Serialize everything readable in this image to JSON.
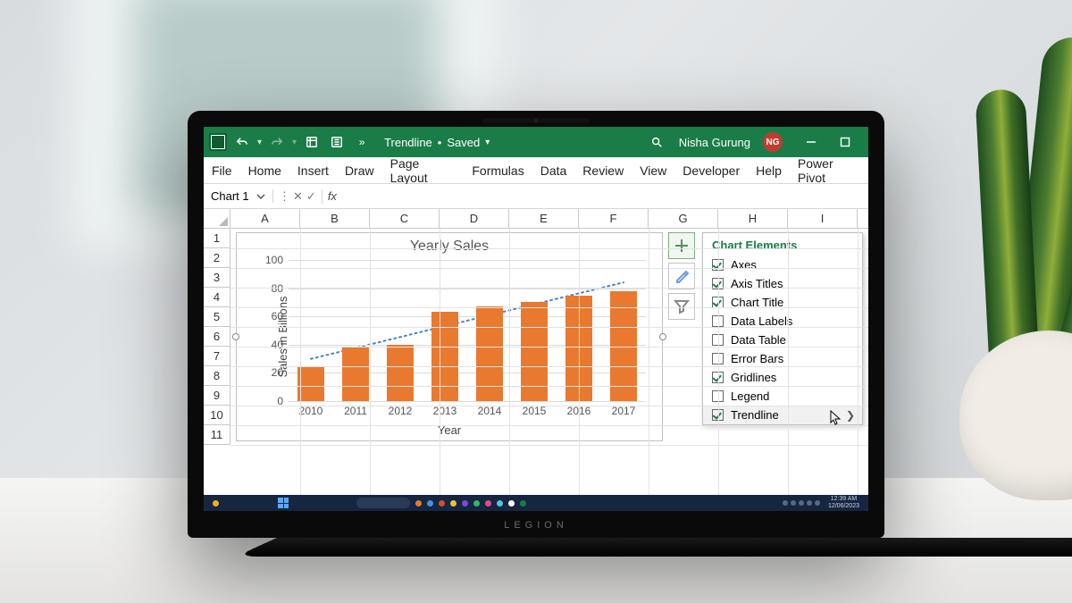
{
  "titlebar": {
    "doc_name": "Trendline",
    "save_state": "Saved",
    "user_name": "Nisha Gurung",
    "user_initials": "NG"
  },
  "ribbon_tabs": [
    "File",
    "Home",
    "Insert",
    "Draw",
    "Page Layout",
    "Formulas",
    "Data",
    "Review",
    "View",
    "Developer",
    "Help",
    "Power Pivot"
  ],
  "namebox": {
    "value": "Chart 1"
  },
  "fx": {
    "label": "fx",
    "value": ""
  },
  "columns": [
    "A",
    "B",
    "C",
    "D",
    "E",
    "F",
    "G",
    "H",
    "I"
  ],
  "rows": [
    "1",
    "2",
    "3",
    "4",
    "5",
    "6",
    "7",
    "8",
    "9",
    "10",
    "11"
  ],
  "chart_elements": {
    "title": "Chart Elements",
    "items": [
      {
        "label": "Axes",
        "checked": true
      },
      {
        "label": "Axis Titles",
        "checked": true
      },
      {
        "label": "Chart Title",
        "checked": true
      },
      {
        "label": "Data Labels",
        "checked": false
      },
      {
        "label": "Data Table",
        "checked": false
      },
      {
        "label": "Error Bars",
        "checked": false
      },
      {
        "label": "Gridlines",
        "checked": true
      },
      {
        "label": "Legend",
        "checked": false
      },
      {
        "label": "Trendline",
        "checked": true,
        "hover": true,
        "expand": true
      }
    ]
  },
  "chart_data": {
    "type": "bar",
    "title": "Yearly Sales",
    "xlabel": "Year",
    "ylabel": "Sales in Billions",
    "categories": [
      "2010",
      "2011",
      "2012",
      "2013",
      "2014",
      "2015",
      "2016",
      "2017"
    ],
    "values": [
      25,
      38,
      40,
      63,
      67,
      70,
      75,
      78
    ],
    "ylim": [
      0,
      100
    ],
    "yticks": [
      0,
      20,
      40,
      60,
      80,
      100
    ],
    "trendline": true,
    "trend_style": "dotted"
  },
  "laptop_brand": "LEGION",
  "colors": {
    "accent": "#1a7d47",
    "bar": "#e9792f",
    "trend": "#4a84c4",
    "user_badge": "#c23b2e"
  }
}
